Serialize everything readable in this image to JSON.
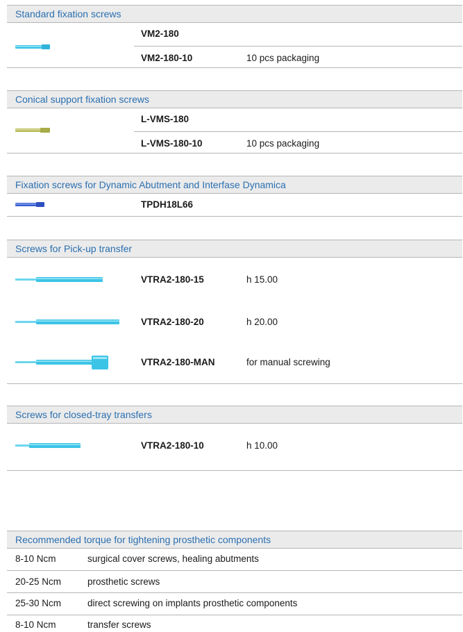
{
  "sections": [
    {
      "title": "Standard fixation screws",
      "rows": [
        {
          "code": "VM2-180",
          "desc": ""
        },
        {
          "code": "VM2-180-10",
          "desc": "10 pcs packaging"
        }
      ],
      "image": "standard-fixation-screw-icon"
    },
    {
      "title": "Conical support fixation screws",
      "rows": [
        {
          "code": "L-VMS-180",
          "desc": ""
        },
        {
          "code": "L-VMS-180-10",
          "desc": "10 pcs packaging"
        }
      ],
      "image": "conical-support-screw-icon"
    },
    {
      "title": "Fixation screws for Dynamic Abutment and Interfase Dynamica",
      "rows": [
        {
          "code": "TPDH18L66",
          "desc": ""
        }
      ],
      "image": "dynamic-abutment-screw-icon"
    },
    {
      "title": "Screws for Pick-up transfer",
      "rows": [
        {
          "code": "VTRA2-180-15",
          "desc": "h 15.00",
          "image": "pickup-screw-15-icon"
        },
        {
          "code": "VTRA2-180-20",
          "desc": "h 20.00",
          "image": "pickup-screw-20-icon"
        },
        {
          "code": "VTRA2-180-MAN",
          "desc": "for manual screwing",
          "image": "pickup-screw-manual-icon"
        }
      ]
    },
    {
      "title": "Screws for closed-tray transfers",
      "rows": [
        {
          "code": "VTRA2-180-10",
          "desc": "h 10.00",
          "image": "closed-tray-screw-icon"
        }
      ]
    }
  ],
  "torque": {
    "title": "Recommended torque for tightening prosthetic components",
    "rows": [
      {
        "value": "8-10 Ncm",
        "desc": "surgical cover screws, healing abutments"
      },
      {
        "value": "20-25 Ncm",
        "desc": "prosthetic screws"
      },
      {
        "value": "25-30 Ncm",
        "desc": "direct screwing on implants prosthetic components"
      },
      {
        "value": "8-10 Ncm",
        "desc": "transfer screws"
      }
    ]
  },
  "colors": {
    "header_text": "#2a6fb0",
    "header_bg": "#ebebeb",
    "screw_cyan": "#3cc4e6",
    "screw_gold": "#b8bb5a",
    "screw_blue": "#3a5fd0"
  }
}
